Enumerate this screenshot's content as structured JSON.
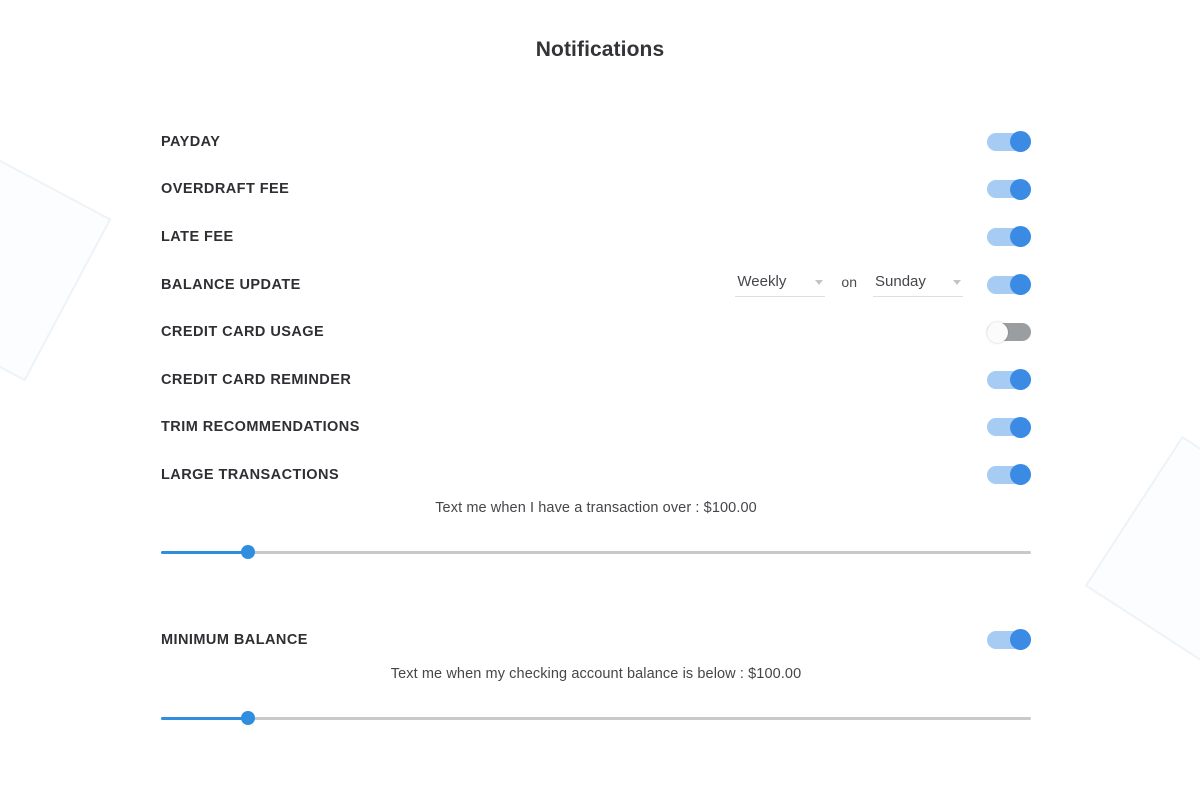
{
  "header": {
    "title": "Notifications"
  },
  "colors": {
    "toggle_on_track": "#a6ccf4",
    "toggle_on_knob": "#3b8be5",
    "toggle_off_track": "#9b9ea1",
    "toggle_off_knob": "#fbfbfb",
    "slider_fill": "#2f8ede",
    "slider_rail": "#c9c9c9",
    "label_text": "#2e2f33"
  },
  "notifications": [
    {
      "label": "PAYDAY",
      "toggle": "on",
      "toggle_icon": "toggle-on-icon"
    },
    {
      "label": "OVERDRAFT FEE",
      "toggle": "on",
      "toggle_icon": "toggle-on-icon"
    },
    {
      "label": "LATE FEE",
      "toggle": "on",
      "toggle_icon": "toggle-on-icon"
    },
    {
      "label": "BALANCE UPDATE",
      "toggle": "on",
      "toggle_icon": "toggle-on-icon"
    },
    {
      "label": "CREDIT CARD USAGE",
      "toggle": "off",
      "toggle_icon": "toggle-off-icon"
    },
    {
      "label": "CREDIT CARD REMINDER",
      "toggle": "on",
      "toggle_icon": "toggle-on-icon"
    },
    {
      "label": "TRIM RECOMMENDATIONS",
      "toggle": "on",
      "toggle_icon": "toggle-on-icon"
    },
    {
      "label": "LARGE TRANSACTIONS",
      "toggle": "on",
      "toggle_icon": "toggle-on-icon"
    }
  ],
  "schedule": {
    "frequency_value": "Weekly",
    "conjunction": "on",
    "day_value": "Sunday",
    "caret_icon": "chevron-down-icon"
  },
  "large_transactions": {
    "caption": "Text me when I have a transaction over : $100.00",
    "amount": "$100.00",
    "slider_percent": 10
  },
  "minimum_balance": {
    "label": "MINIMUM BALANCE",
    "toggle": "on",
    "toggle_icon": "toggle-on-icon",
    "caption": "Text me when my checking account balance is below : $100.00",
    "amount": "$100.00",
    "slider_percent": 10
  }
}
